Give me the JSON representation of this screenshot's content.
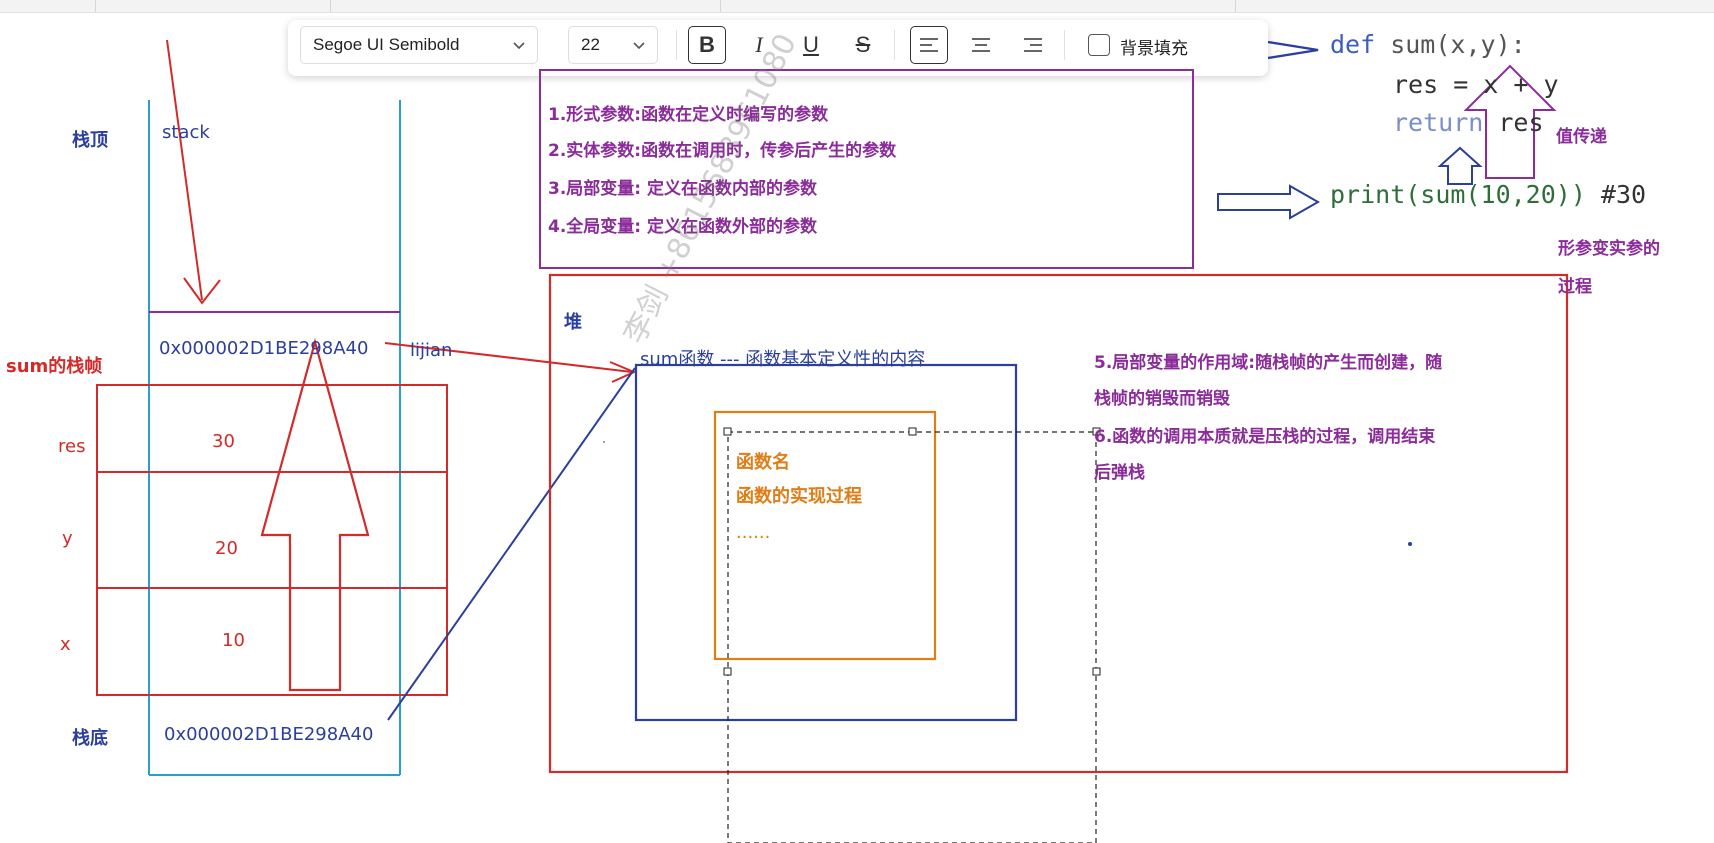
{
  "toolbar": {
    "font_family": "Segoe UI Semibold",
    "font_size": "22",
    "bold": "B",
    "italic": "I",
    "underline": "U",
    "strike": "S",
    "bg_fill_label": "背景填充"
  },
  "code": {
    "def_kw": "def",
    "def_sig": " sum(x,y):",
    "line2": "res = x + y",
    "return_kw": "return",
    "return_val": " res",
    "print_line": "print(sum(10,20))",
    "print_comment": " #30"
  },
  "annotations": {
    "value_pass": "值传递",
    "param_process_1": "形参变实参的",
    "param_process_2": "过程"
  },
  "notes": {
    "n1": "1.形式参数:函数在定义时编写的参数",
    "n2": "2.实体参数:函数在调用时，传参后产生的参数",
    "n3": "3.局部变量: 定义在函数内部的参数",
    "n4": "4.全局变量: 定义在函数外部的参数",
    "n5a": "5.局部变量的作用域:随栈帧的产生而创建，随",
    "n5b": "栈帧的销毁而销毁",
    "n6a": "6.函数的调用本质就是压栈的过程，调用结束",
    "n6b": "后弹栈"
  },
  "stack": {
    "top_label": "栈顶",
    "stack_label": "stack",
    "frame_label": "sum的栈帧",
    "addr_top": "0x000002D1BE298A40",
    "lijian": "lijian",
    "rows": [
      {
        "name": "res",
        "value": "30"
      },
      {
        "name": "y",
        "value": "20"
      },
      {
        "name": "x",
        "value": "10"
      }
    ],
    "bottom_label": "栈底",
    "addr_bottom": "0x000002D1BE298A40"
  },
  "heap": {
    "label": "堆",
    "sum_func_label": "sum函数  --- 函数基本定义性的内容",
    "inner_1": "函数名",
    "inner_2": "函数的实现过程",
    "inner_3": "......"
  },
  "watermark": "李剑 +8615683961080"
}
